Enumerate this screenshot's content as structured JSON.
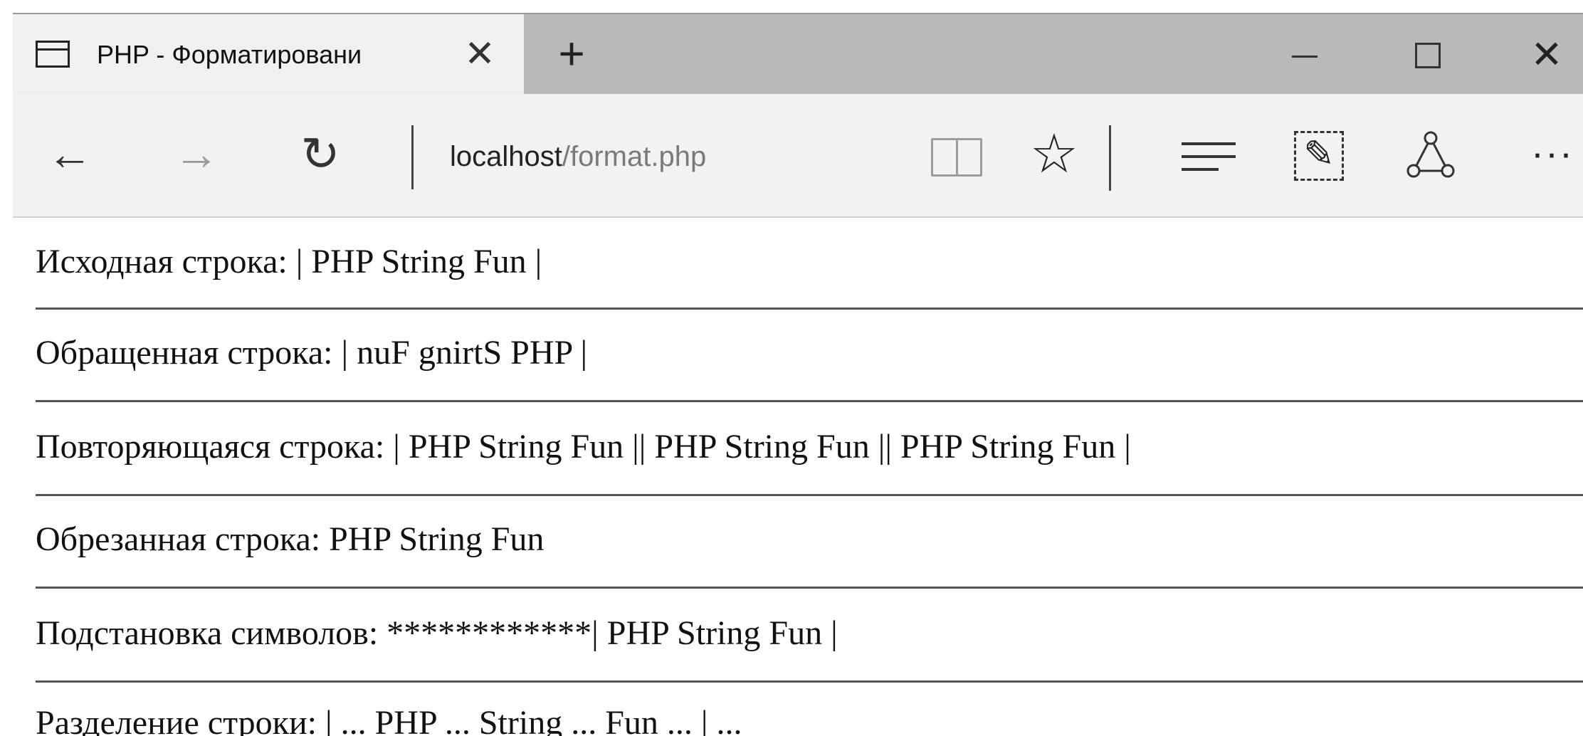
{
  "browser": {
    "tab": {
      "title": "PHP - Форматировани"
    },
    "address": {
      "host": "localhost",
      "path": "/format.php"
    },
    "icons": {
      "tab_page": "page-icon",
      "tab_close": "close-icon",
      "new_tab": "plus-icon",
      "minimize": "minimize-icon",
      "maximize": "maximize-icon",
      "close_window": "close-icon",
      "back": "arrow-left-icon",
      "forward": "arrow-right-icon",
      "refresh": "refresh-icon",
      "reading_view": "book-icon",
      "favorite": "star-icon",
      "hub": "hub-icon",
      "web_note": "pen-icon",
      "share": "share-icon",
      "more": "more-icon"
    },
    "glyphs": {
      "tab_close": "✕",
      "new_tab": "+",
      "close_window": "✕",
      "back": "←",
      "forward": "→",
      "refresh": "↻",
      "favorite": "☆",
      "web_note": "✎",
      "more": "···"
    }
  },
  "content": {
    "lines": [
      "Исходная строка: | PHP String Fun |",
      "Обращенная строка: | nuF gnirtS PHP |",
      "Повторяющаяся строка: | PHP String Fun || PHP String Fun || PHP String Fun |",
      "Обрезанная строка: PHP String Fun",
      "Подстановка символов: ************| PHP String Fun |",
      "Разделение строки: | ... PHP ... String ... Fun ... | ..."
    ]
  },
  "colors": {
    "tabbar_bg": "#b9b9b9",
    "active_tab_bg": "#f0f0f0",
    "navbar_bg": "#f2f2f2",
    "url_path": "#7a7a7a",
    "divider": "#555555"
  }
}
